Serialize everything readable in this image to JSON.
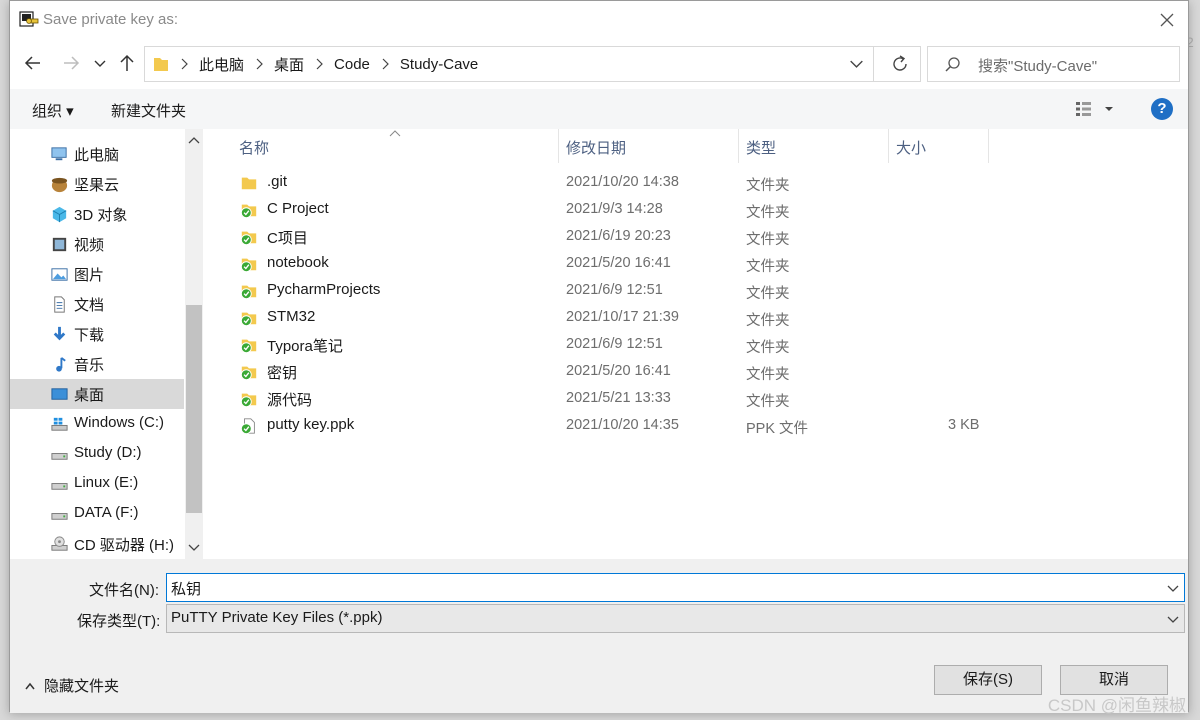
{
  "window": {
    "title": "Save private key as:",
    "close_icon": "close-icon",
    "app_icon": "putty-key-icon"
  },
  "nav": {
    "back_icon": "arrow-left-icon",
    "forward_icon": "arrow-right-icon",
    "recent_icon": "chevron-down-icon",
    "up_icon": "arrow-up-icon",
    "breadcrumbs": [
      "此电脑",
      "桌面",
      "Code",
      "Study-Cave"
    ],
    "refresh_icon": "refresh-icon",
    "search_placeholder": "搜索\"Study-Cave\""
  },
  "toolbar": {
    "organize_label": "组织 ▾",
    "new_folder_label": "新建文件夹",
    "help_label": "?"
  },
  "sidebar": {
    "items": [
      {
        "label": "此电脑",
        "icon": "computer-icon"
      },
      {
        "label": "坚果云",
        "icon": "nut-cloud-icon"
      },
      {
        "label": "3D 对象",
        "icon": "cube-3d-icon"
      },
      {
        "label": "视频",
        "icon": "video-icon"
      },
      {
        "label": "图片",
        "icon": "picture-icon"
      },
      {
        "label": "文档",
        "icon": "document-icon"
      },
      {
        "label": "下载",
        "icon": "download-icon"
      },
      {
        "label": "音乐",
        "icon": "music-icon"
      },
      {
        "label": "桌面",
        "icon": "desktop-icon"
      },
      {
        "label": "Windows (C:)",
        "icon": "windows-drive-icon"
      },
      {
        "label": "Study (D:)",
        "icon": "drive-icon"
      },
      {
        "label": "Linux (E:)",
        "icon": "drive-icon"
      },
      {
        "label": "DATA (F:)",
        "icon": "drive-icon"
      },
      {
        "label": "CD 驱动器 (H:)",
        "icon": "cd-drive-icon"
      }
    ],
    "selected_index": 8
  },
  "filelist": {
    "columns": {
      "name": "名称",
      "date": "修改日期",
      "type": "类型",
      "size": "大小"
    },
    "rows": [
      {
        "name": ".git",
        "date": "2021/10/20 14:38",
        "type": "文件夹",
        "size": "",
        "icon": "folder-icon"
      },
      {
        "name": "C Project",
        "date": "2021/9/3 14:28",
        "type": "文件夹",
        "size": "",
        "icon": "synced-folder-icon"
      },
      {
        "name": "C项目",
        "date": "2021/6/19 20:23",
        "type": "文件夹",
        "size": "",
        "icon": "synced-folder-icon"
      },
      {
        "name": "notebook",
        "date": "2021/5/20 16:41",
        "type": "文件夹",
        "size": "",
        "icon": "synced-folder-icon"
      },
      {
        "name": "PycharmProjects",
        "date": "2021/6/9 12:51",
        "type": "文件夹",
        "size": "",
        "icon": "synced-folder-icon"
      },
      {
        "name": "STM32",
        "date": "2021/10/17 21:39",
        "type": "文件夹",
        "size": "",
        "icon": "synced-folder-icon"
      },
      {
        "name": "Typora笔记",
        "date": "2021/6/9 12:51",
        "type": "文件夹",
        "size": "",
        "icon": "synced-folder-icon"
      },
      {
        "name": "密钥",
        "date": "2021/5/20 16:41",
        "type": "文件夹",
        "size": "",
        "icon": "synced-folder-icon"
      },
      {
        "name": "源代码",
        "date": "2021/5/21 13:33",
        "type": "文件夹",
        "size": "",
        "icon": "synced-folder-icon"
      },
      {
        "name": "putty key.ppk",
        "date": "2021/10/20 14:35",
        "type": "PPK 文件",
        "size": "3 KB",
        "icon": "synced-file-icon"
      }
    ]
  },
  "bottom": {
    "filename_label": "文件名(N):",
    "filename_value": "私钥",
    "filetype_label": "保存类型(T):",
    "filetype_value": "PuTTY Private Key Files (*.ppk)",
    "hide_folders_label": "隐藏文件夹",
    "save_label": "保存(S)",
    "cancel_label": "取消"
  },
  "watermark": "CSDN @闲鱼辣椒",
  "colors": {
    "accent": "#0078d7",
    "help": "#1f6fc5",
    "sync_green": "#3aa935",
    "folder_yellow": "#f3c94e"
  }
}
